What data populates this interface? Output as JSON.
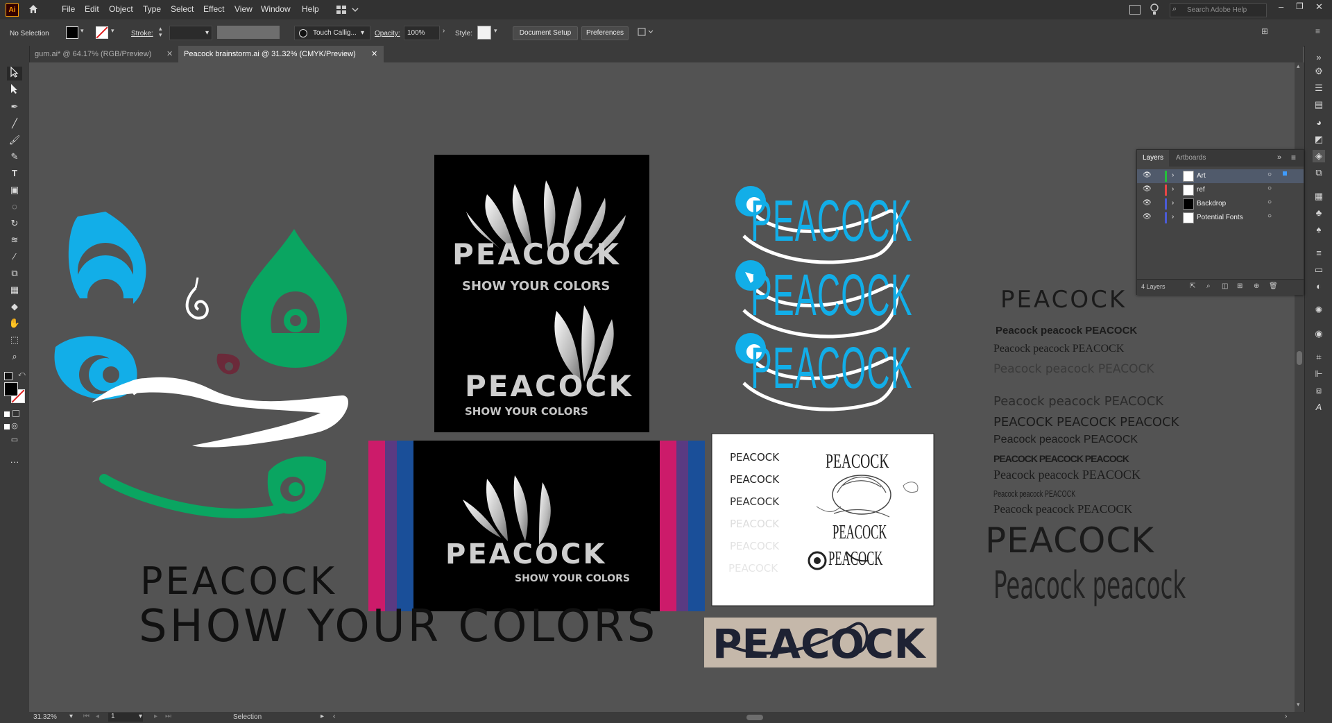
{
  "app": {
    "logo_text": "Ai"
  },
  "menu": [
    "File",
    "Edit",
    "Object",
    "Type",
    "Select",
    "Effect",
    "View",
    "Window",
    "Help"
  ],
  "search": {
    "placeholder": "Search Adobe Help"
  },
  "control_bar": {
    "selection_status": "No Selection",
    "stroke_label": "Stroke:",
    "brush_name": "Touch Callig...",
    "opacity_label": "Opacity:",
    "opacity_value": "100%",
    "style_label": "Style:",
    "document_setup": "Document Setup",
    "preferences": "Preferences"
  },
  "tabs": [
    {
      "label": "gum.ai* @ 64.17% (RGB/Preview)",
      "active": false
    },
    {
      "label": "Peacock brainstorm.ai @ 31.32% (CMYK/Preview)",
      "active": true
    }
  ],
  "layers_panel": {
    "tabs": [
      "Layers",
      "Artboards"
    ],
    "layers": [
      {
        "name": "Art",
        "color": "#24c13a",
        "selected": true
      },
      {
        "name": "ref",
        "color": "#e84646",
        "selected": false
      },
      {
        "name": "Backdrop",
        "color": "#4b5bd6",
        "selected": false
      },
      {
        "name": "Potential Fonts",
        "color": "#4b5bd6",
        "selected": false
      }
    ],
    "count_label": "4 Layers"
  },
  "artwork": {
    "wordmark": "PEACOCK",
    "tagline": "SHOW YOUR COLORS",
    "sketch_lines": [
      "PEACOCK",
      "PEACOCK",
      "PEACOCK",
      "PEACOCK",
      "PEACOCK",
      "PEACOCK"
    ],
    "font_samples": [
      "PEACOCK",
      "Peacock peacock PEACOCK",
      "Peacock peacock PEACOCK",
      "Peacock peacock PEACOCK",
      "Peacock peacock PEACOCK",
      "PEACOCK PEACOCK PEACOCK",
      "Peacock peacock PEACOCK",
      "PEACOCK PEACOCK PEACOCK",
      "Peacock peacock PEACOCK",
      "Peacock peacock PEACOCK",
      "Peacock peacock PEACOCK",
      "PEACOCK",
      "Peacock peacock"
    ],
    "colors": {
      "blue": "#12aee8",
      "green": "#0aa561",
      "magenta": "#cc1b6a",
      "purple": "#5a3a82",
      "navy": "#1a4f99",
      "maroon": "#6b2a3a"
    }
  },
  "status": {
    "zoom": "31.32%",
    "artboard": "1",
    "tool": "Selection"
  }
}
